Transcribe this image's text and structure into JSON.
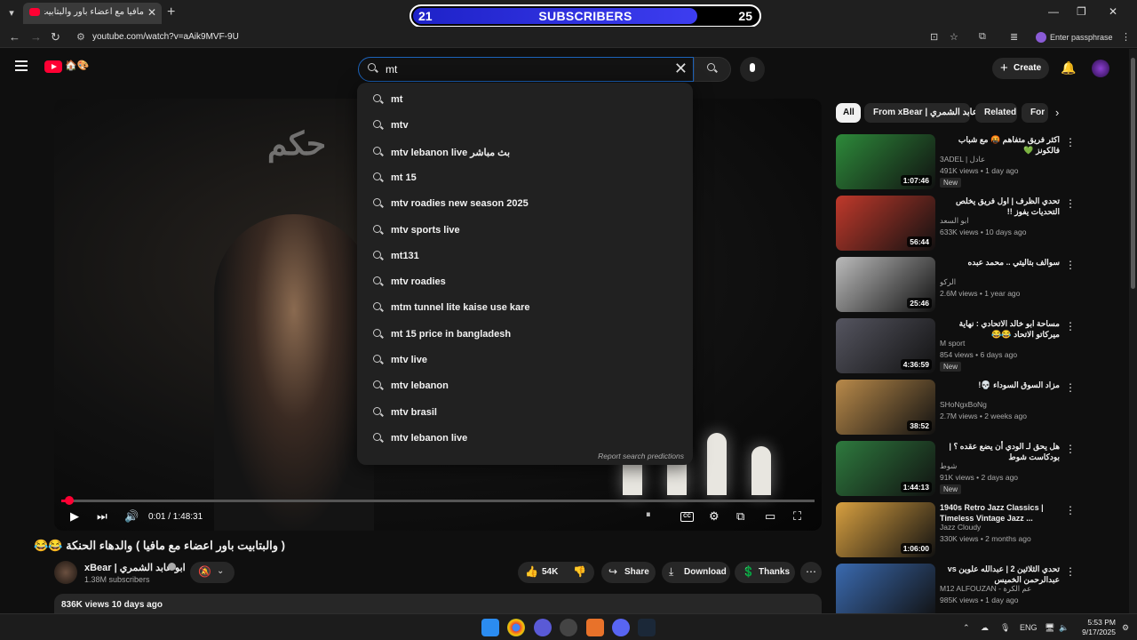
{
  "browser": {
    "tab_title": "مافيا مع اعضاء باور والبتابيت ( ال",
    "url": "youtube.com/watch?v=aAik9MVF-9U",
    "passphrase_label": "Enter passphrase"
  },
  "sub_counter": {
    "left_value": "21",
    "label": "SUBSCRIBERS",
    "right_value": "25",
    "progress": 0.82
  },
  "header": {
    "create_label": "Create"
  },
  "search": {
    "query": "mt",
    "placeholder": "Search",
    "suggestions": [
      "mt",
      "mtv",
      "mtv lebanon live بث مباشر",
      "mt 15",
      "mtv roadies new season 2025",
      "mtv sports live",
      "mt131",
      "mtv roadies",
      "mtm tunnel lite kaise use kare",
      "mt 15 price in bangladesh",
      "mtv live",
      "mtv lebanon",
      "mtv brasil",
      "mtv lebanon live"
    ],
    "report_label": "Report search predictions"
  },
  "player": {
    "time": "0:01 / 1:48:31",
    "progress": 0.001
  },
  "video": {
    "title": "( والبتابيت باور اعضاء مع مافيا ) والدهاء الحنكة 😂😂",
    "channel": "xBear | ابو عابد الشمري",
    "subscribers": "1.38M subscribers",
    "likes": "54K",
    "share_label": "Share",
    "download_label": "Download",
    "thanks_label": "Thanks",
    "views_date": "836K views  10 days ago"
  },
  "chips": [
    "All",
    "From xBear | ابو عابد الشمري",
    "Related",
    "For"
  ],
  "recommendations": [
    {
      "title": "اكثر فريق متفاهم 🤬 مع شباب فالكونز 💚",
      "channel": "3ADEL | عادل",
      "meta": "491K views • 1 day ago",
      "badge": "New",
      "duration": "1:07:46",
      "thumb": "#2d8a3a"
    },
    {
      "title": "تحدي الظرف | اول فريق يخلص التحديات يفوز !!",
      "channel": "ابو السعد",
      "meta": "633K views • 10 days ago",
      "badge": "",
      "duration": "56:44",
      "thumb": "#c0392b"
    },
    {
      "title": "سوالف بتاليتي .. محمد عبده",
      "channel": "الركو",
      "meta": "2.6M views • 1 year ago",
      "badge": "",
      "duration": "25:46",
      "thumb": "#bbbbbb"
    },
    {
      "title": "مساحة ابو خالد الاتحادي : نهاية ميركاتو الاتحاد 😂😂",
      "channel": "M sport",
      "meta": "854 views • 6 days ago",
      "badge": "New",
      "duration": "4:36:59",
      "thumb": "#555560"
    },
    {
      "title": "مزاد السوق السوداء 💀!",
      "channel": "SHoNgxBoNg",
      "meta": "2.7M views • 2 weeks ago",
      "badge": "",
      "duration": "38:52",
      "thumb": "#b98a4a"
    },
    {
      "title": "هل يحق لـ الودي أن يضع عقده ؟ | بودكاست شوط",
      "channel": "شوط",
      "meta": "91K views • 2 days ago",
      "badge": "New",
      "duration": "1:44:13",
      "thumb": "#2e7a3e"
    },
    {
      "title": "1940s Retro Jazz Classics | Timeless Vintage Jazz ...",
      "channel": "Jazz Cloudy",
      "meta": "330K views • 2 months ago",
      "badge": "",
      "duration": "1:06:00",
      "thumb": "#d8a040",
      "ltr": true
    },
    {
      "title": "تحدي الثلاثين 2 | عبدالله علوين vs عبدالرحمن الخميس",
      "channel": "M12 ALFOUZAN - عم الكرة",
      "meta": "985K views • 1 day ago",
      "badge": "",
      "duration": "",
      "thumb": "#3a6ab0"
    }
  ],
  "taskbar": {
    "lang": "ENG",
    "time": "5:53 PM",
    "date": "9/17/2025"
  }
}
